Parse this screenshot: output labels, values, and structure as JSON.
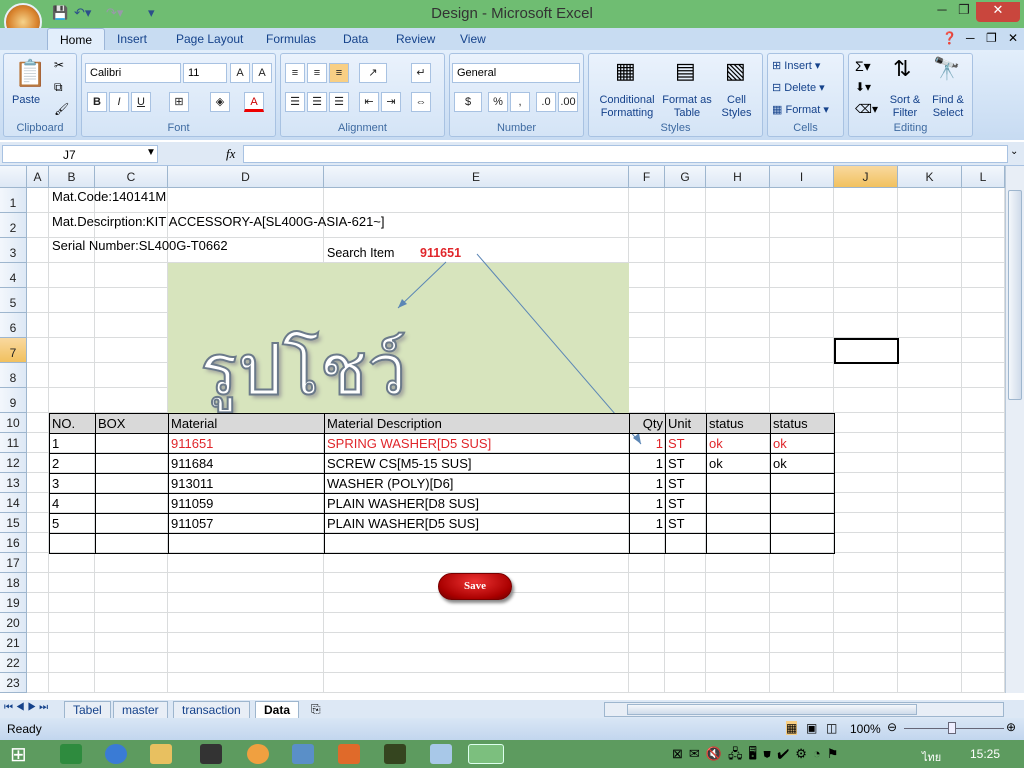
{
  "window": {
    "title": "Design - Microsoft Excel"
  },
  "ribbon": {
    "tabs": [
      "Home",
      "Insert",
      "Page Layout",
      "Formulas",
      "Data",
      "Review",
      "View"
    ],
    "clipboard": {
      "paste": "Paste",
      "label": "Clipboard"
    },
    "font": {
      "name": "Calibri",
      "size": "11",
      "label": "Font",
      "bold": "B",
      "italic": "I",
      "underline": "U"
    },
    "alignment": {
      "label": "Alignment"
    },
    "number": {
      "format": "General",
      "percent": "%",
      "comma": ",",
      "label": "Number"
    },
    "styles": {
      "conditional": "Conditional Formatting",
      "format_table": "Format as Table",
      "cell_styles": "Cell Styles",
      "label": "Styles"
    },
    "cells": {
      "insert": "Insert",
      "delete": "Delete",
      "format": "Format",
      "label": "Cells"
    },
    "editing": {
      "sort": "Sort & Filter",
      "find": "Find & Select",
      "label": "Editing"
    }
  },
  "formula_bar": {
    "name_box": "J7",
    "fx": "fx",
    "value": ""
  },
  "columns": [
    "A",
    "B",
    "C",
    "D",
    "E",
    "F",
    "G",
    "H",
    "I",
    "J",
    "K",
    "L"
  ],
  "rows": [
    "1",
    "2",
    "3",
    "4",
    "5",
    "6",
    "7",
    "8",
    "9",
    "10",
    "11",
    "12",
    "13",
    "14",
    "15",
    "16",
    "17",
    "18",
    "19",
    "20",
    "21",
    "22",
    "23"
  ],
  "sheet": {
    "mat_code": "Mat.Code:140141M",
    "mat_desc": "Mat.Descirption:KIT ACCESSORY-A[SL400G-ASIA-621~]",
    "serial": "Serial Number:SL400G-T0662",
    "search_label": "Search  Item",
    "search_value": "911651",
    "picture_text": "รูปโชว์",
    "headers": [
      "NO.",
      "BOX",
      "Material",
      "Material Description",
      "Qty",
      "Unit",
      "status",
      "status"
    ],
    "items": [
      {
        "no": "1",
        "box": "",
        "material": "911651",
        "desc": "SPRING WASHER[D5 SUS]",
        "qty": "1",
        "unit": "ST",
        "status1": "ok",
        "status2": "ok"
      },
      {
        "no": "2",
        "box": "",
        "material": "911684",
        "desc": "SCREW CS[M5-15 SUS]",
        "qty": "1",
        "unit": "ST",
        "status1": "ok",
        "status2": "ok"
      },
      {
        "no": "3",
        "box": "",
        "material": "913011",
        "desc": "WASHER (POLY)[D6]",
        "qty": "1",
        "unit": "ST",
        "status1": "",
        "status2": ""
      },
      {
        "no": "4",
        "box": "",
        "material": "911059",
        "desc": "PLAIN WASHER[D8 SUS]",
        "qty": "1",
        "unit": "ST",
        "status1": "",
        "status2": ""
      },
      {
        "no": "5",
        "box": "",
        "material": "911057",
        "desc": "PLAIN WASHER[D5 SUS]",
        "qty": "1",
        "unit": "ST",
        "status1": "",
        "status2": ""
      }
    ],
    "save_label": "Save"
  },
  "sheet_tabs": [
    "Tabel",
    "master",
    "transaction",
    "Data"
  ],
  "active_sheet": "Data",
  "status": {
    "ready": "Ready",
    "zoom": "100%"
  },
  "taskbar": {
    "lang": "ไทย",
    "time": "15:25"
  },
  "colors": {
    "highlight": "#e0262b",
    "picture_bg": "#d7e4bd",
    "titlebar": "#6fbd72"
  }
}
